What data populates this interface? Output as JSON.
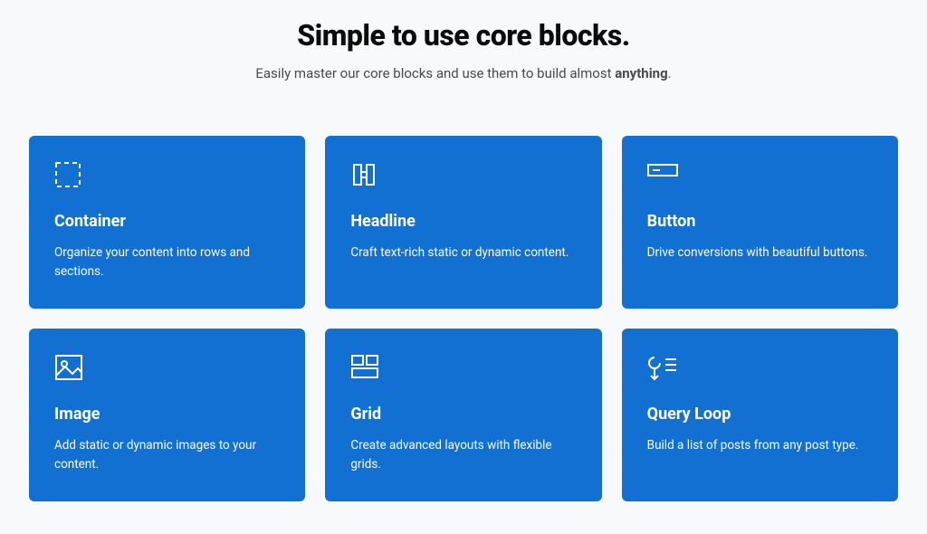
{
  "header": {
    "title": "Simple to use core blocks.",
    "subtitle_pre": "Easily master our core blocks and use them to build almost ",
    "subtitle_bold": "anything",
    "subtitle_post": "."
  },
  "cards": [
    {
      "icon": "container-icon",
      "title": "Container",
      "desc": "Organize your content into rows and sections."
    },
    {
      "icon": "headline-icon",
      "title": "Headline",
      "desc": "Craft text-rich static or dynamic content."
    },
    {
      "icon": "button-icon",
      "title": "Button",
      "desc": "Drive conversions with beautiful buttons."
    },
    {
      "icon": "image-icon",
      "title": "Image",
      "desc": "Add static or dynamic images to your content."
    },
    {
      "icon": "grid-icon",
      "title": "Grid",
      "desc": "Create advanced layouts with flexible grids."
    },
    {
      "icon": "query-loop-icon",
      "title": "Query Loop",
      "desc": "Build a list of posts from any post type."
    }
  ]
}
